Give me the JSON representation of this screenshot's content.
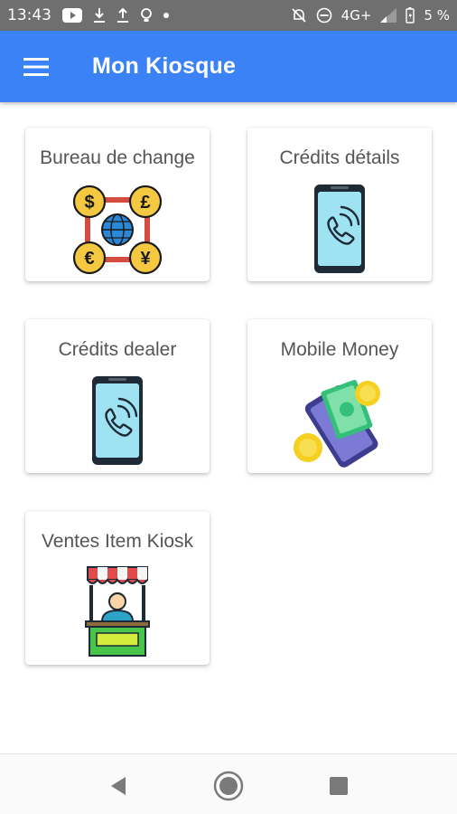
{
  "status_bar": {
    "time": "13:43",
    "network": "4G+",
    "battery": "5 %"
  },
  "app_bar": {
    "title": "Mon Kiosque"
  },
  "cards": [
    {
      "label": "Bureau de change",
      "icon": "currency-exchange-icon"
    },
    {
      "label": "Crédits détails",
      "icon": "phone-call-icon"
    },
    {
      "label": "Crédits dealer",
      "icon": "phone-call-icon"
    },
    {
      "label": "Mobile Money",
      "icon": "mobile-money-icon"
    },
    {
      "label": "Ventes Item Kiosk",
      "icon": "kiosk-stand-icon"
    }
  ],
  "colors": {
    "app_bar": "#3b82f6",
    "status_bar": "#6f6f6f"
  }
}
